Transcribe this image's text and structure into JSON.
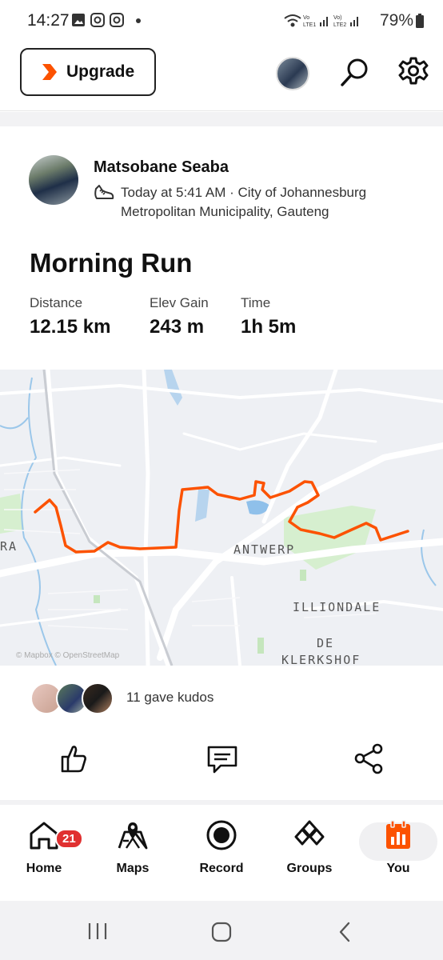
{
  "status_bar": {
    "time": "14:27",
    "battery": "79%",
    "icons": [
      "gallery-icon",
      "instagram-icon",
      "instagram-icon",
      "dot-icon",
      "wifi-icon",
      "signal-lte1-icon",
      "signal-lte2-icon",
      "battery-icon"
    ]
  },
  "header": {
    "upgrade_label": "Upgrade",
    "accent": "#fc5200"
  },
  "activity": {
    "athlete_name": "Matsobane Seaba",
    "meta_line1": "Today at 5:41 AM · City of Johannesburg",
    "meta_line2": "Metropolitan Municipality, Gauteng",
    "title": "Morning Run",
    "stats": [
      {
        "label": "Distance",
        "value": "12.15 km"
      },
      {
        "label": "Elev Gain",
        "value": "243 m"
      },
      {
        "label": "Time",
        "value": "1h 5m"
      }
    ],
    "map": {
      "labels": [
        "ANTWERP",
        "ILLIONDALE",
        "DE",
        "KLERKSHOF",
        "RA"
      ],
      "credit": "© Mapbox © OpenStreetMap",
      "route_color": "#fc5200"
    },
    "kudos_text": "11 gave kudos"
  },
  "bottom_nav": {
    "items": [
      {
        "label": "Home",
        "icon": "home-icon",
        "badge": "21"
      },
      {
        "label": "Maps",
        "icon": "maps-icon"
      },
      {
        "label": "Record",
        "icon": "record-icon"
      },
      {
        "label": "Groups",
        "icon": "groups-icon"
      },
      {
        "label": "You",
        "icon": "you-icon"
      }
    ]
  }
}
